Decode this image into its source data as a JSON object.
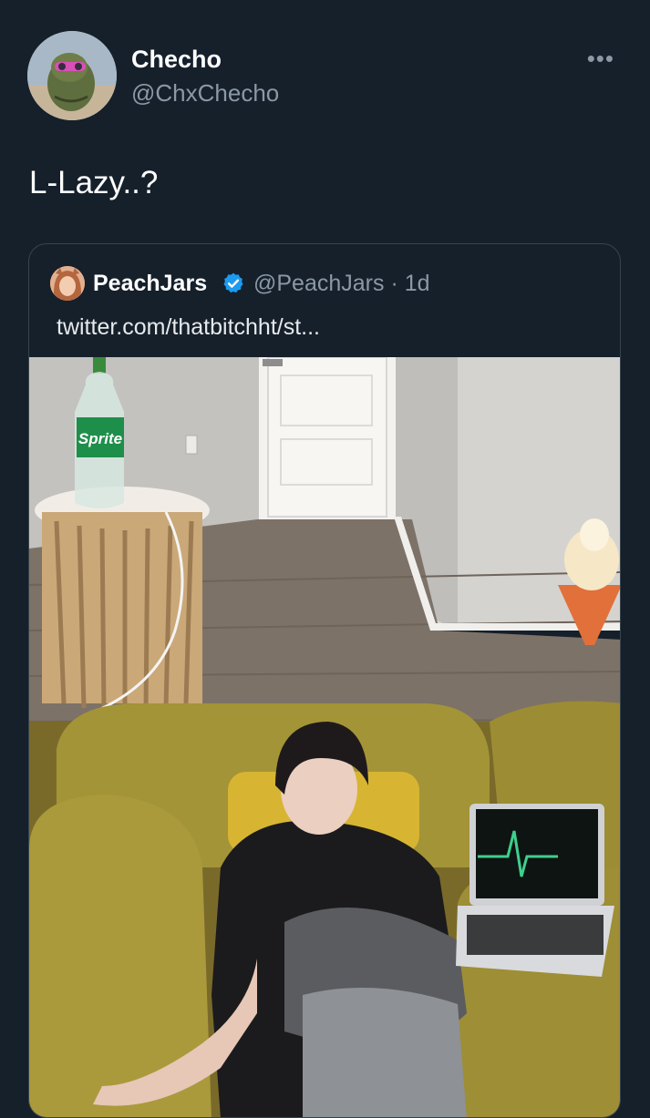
{
  "tweet": {
    "display_name": "Checho",
    "handle": "@ChxChecho",
    "more_icon": "more-horizontal-icon",
    "text": "L-Lazy..?"
  },
  "quoted": {
    "display_name": "PeachJars",
    "verified_icon": "verified-badge-icon",
    "handle": "@PeachJars",
    "separator": "·",
    "age": "1d",
    "meta": "@PeachJars · 1d",
    "link_text": "twitter.com/thatbitchht/st...",
    "photo": {
      "bottle_label": "Sprite"
    }
  },
  "colors": {
    "background": "#15202b",
    "secondary_text": "#8b98a5",
    "border": "#38444d",
    "verified": "#1d9bf0"
  }
}
